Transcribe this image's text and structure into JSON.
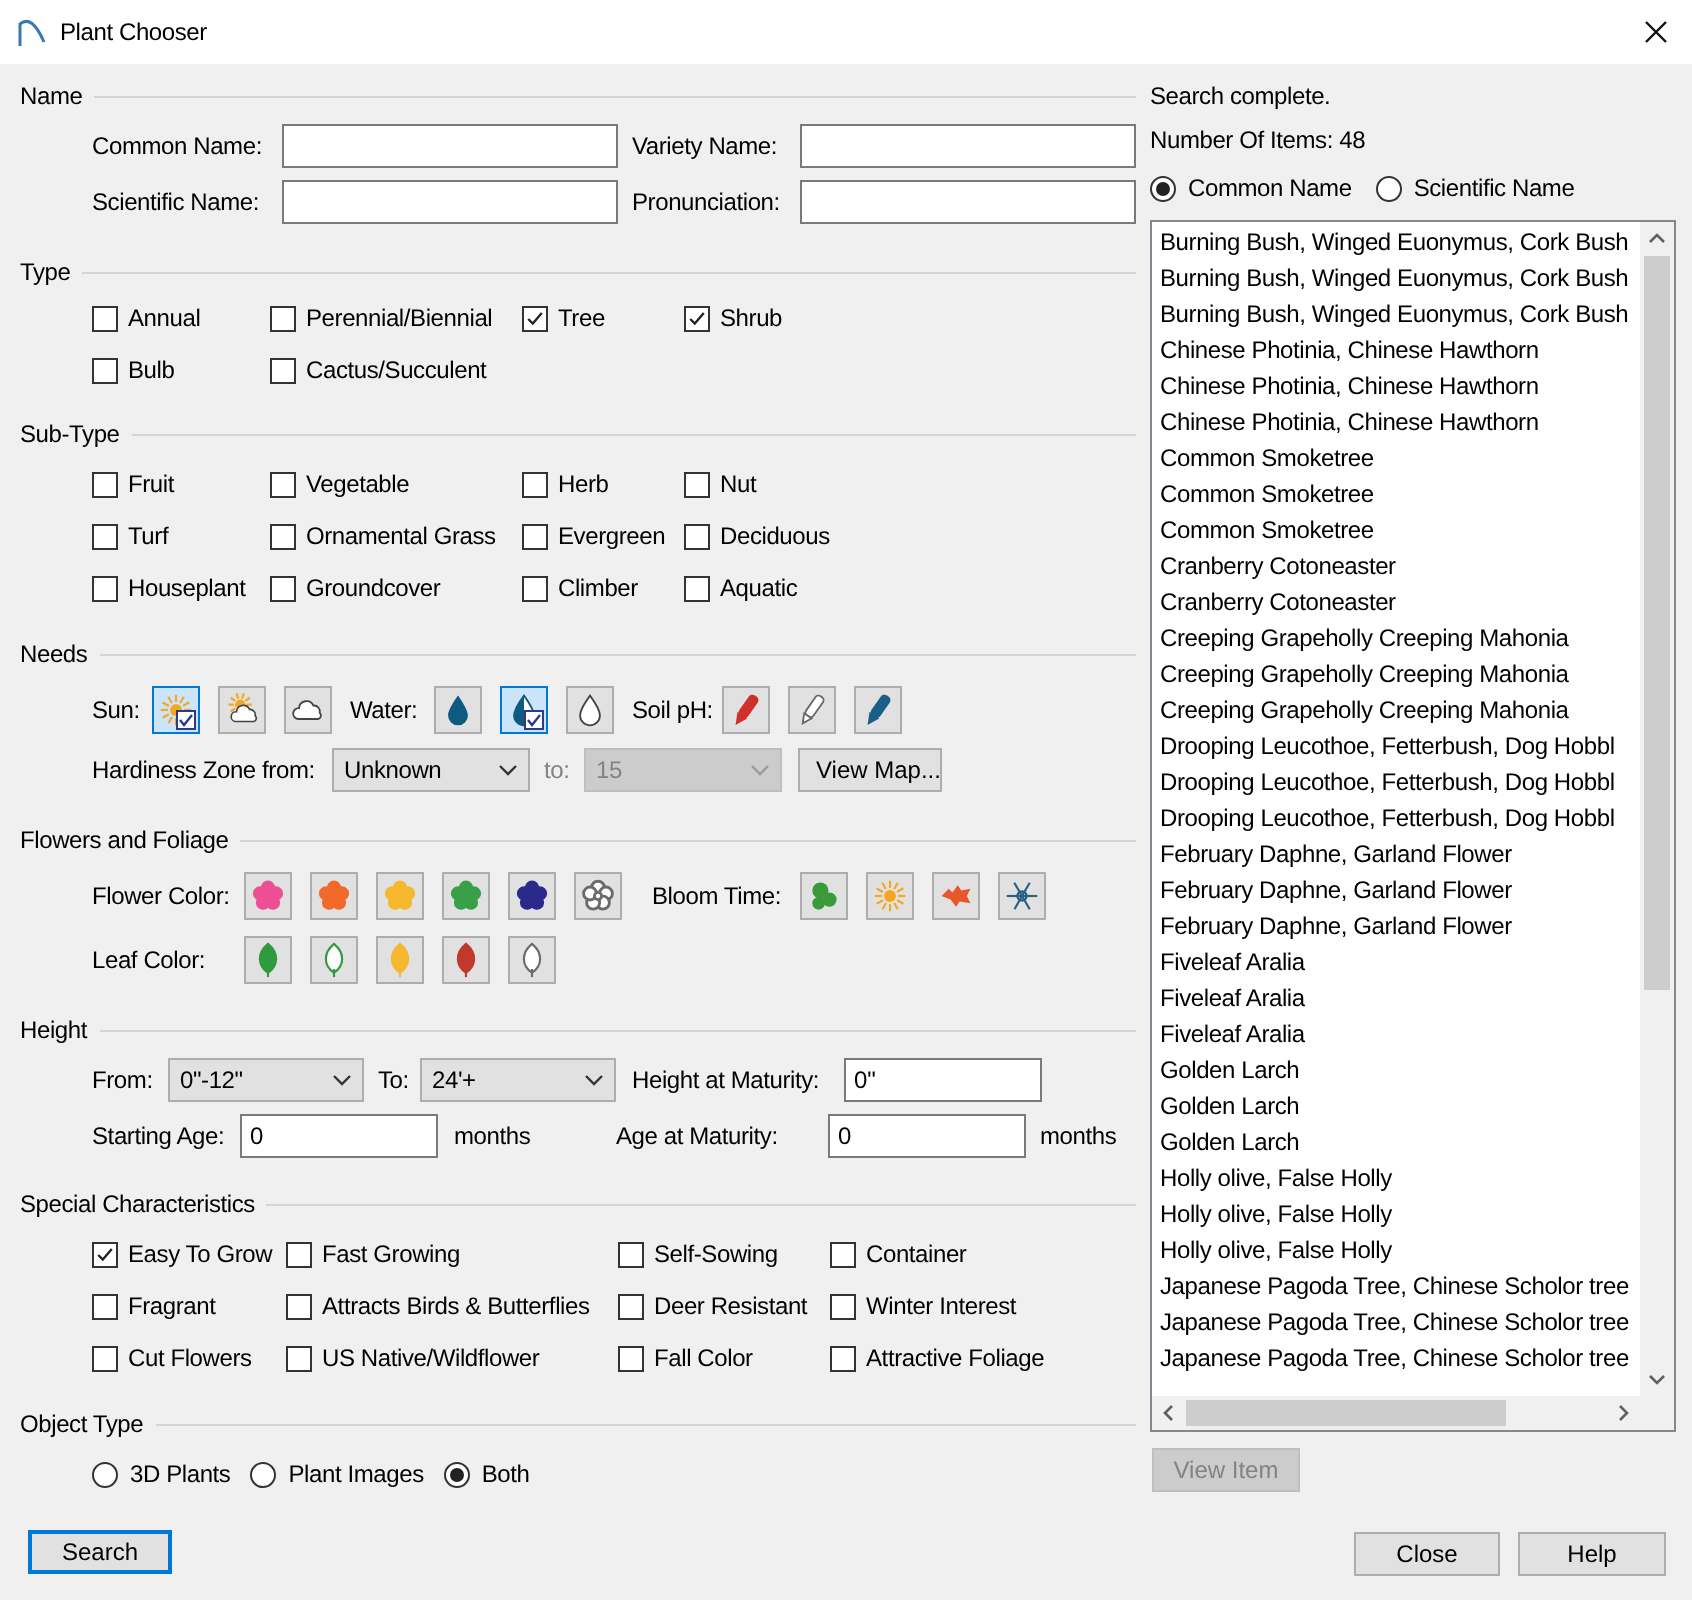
{
  "window": {
    "title": "Plant Chooser"
  },
  "name_section": {
    "title": "Name",
    "fields": [
      {
        "label": "Common Name:"
      },
      {
        "label": "Variety Name:"
      },
      {
        "label": "Scientific Name:"
      },
      {
        "label": "Pronunciation:"
      }
    ]
  },
  "type": {
    "title": "Type",
    "options": [
      {
        "label": "Annual",
        "checked": false
      },
      {
        "label": "Perennial/Biennial",
        "checked": false
      },
      {
        "label": "Tree",
        "checked": true
      },
      {
        "label": "Shrub",
        "checked": true
      },
      {
        "label": "Bulb",
        "checked": false
      },
      {
        "label": "Cactus/Succulent",
        "checked": false
      }
    ]
  },
  "sub_type": {
    "title": "Sub-Type",
    "options": [
      {
        "label": "Fruit",
        "checked": false
      },
      {
        "label": "Vegetable",
        "checked": false
      },
      {
        "label": "Herb",
        "checked": false
      },
      {
        "label": "Nut",
        "checked": false
      },
      {
        "label": "Turf",
        "checked": false
      },
      {
        "label": "Ornamental Grass",
        "checked": false
      },
      {
        "label": "Evergreen",
        "checked": false
      },
      {
        "label": "Deciduous",
        "checked": false
      },
      {
        "label": "Houseplant",
        "checked": false
      },
      {
        "label": "Groundcover",
        "checked": false
      },
      {
        "label": "Climber",
        "checked": false
      },
      {
        "label": "Aquatic",
        "checked": false
      }
    ]
  },
  "needs": {
    "title": "Needs",
    "sun": {
      "label": "Sun:",
      "options": [
        {
          "kind": "full",
          "selected": true
        },
        {
          "kind": "partial",
          "selected": false
        },
        {
          "kind": "shade",
          "selected": false
        }
      ]
    },
    "water": {
      "label": "Water:",
      "options": [
        {
          "kind": "high",
          "selected": false
        },
        {
          "kind": "medium",
          "selected": true
        },
        {
          "kind": "low",
          "selected": false
        }
      ]
    },
    "soil_ph": {
      "label": "Soil pH:",
      "options": [
        {
          "kind": "acidic",
          "selected": false
        },
        {
          "kind": "neutral",
          "selected": false
        },
        {
          "kind": "alkaline",
          "selected": false
        }
      ]
    },
    "hardiness": {
      "label": "Hardiness Zone from:",
      "from": {
        "value": "Unknown",
        "disabled": false
      },
      "to_label": "to:",
      "to": {
        "value": "15",
        "disabled": true
      },
      "map_button": "View Map..."
    }
  },
  "flowers_foliage": {
    "title": "Flowers and Foliage",
    "flower_color": {
      "label": "Flower Color:",
      "options": [
        {
          "kind": "filled",
          "color": "#ec4f93",
          "selected": false
        },
        {
          "kind": "filled",
          "color": "#f26a2b",
          "selected": false
        },
        {
          "kind": "filled",
          "color": "#f5b82e",
          "selected": false
        },
        {
          "kind": "filled",
          "color": "#3aa047",
          "selected": false
        },
        {
          "kind": "filled",
          "color": "#2b2a8c",
          "selected": false
        },
        {
          "kind": "outline",
          "color": "#6b6b6b",
          "selected": false
        }
      ]
    },
    "bloom_time": {
      "label": "Bloom Time:",
      "options": [
        {
          "kind": "spring",
          "selected": false
        },
        {
          "kind": "summer",
          "selected": false
        },
        {
          "kind": "fall",
          "selected": false
        },
        {
          "kind": "winter",
          "selected": false
        }
      ]
    },
    "leaf_color": {
      "label": "Leaf Color:",
      "options": [
        {
          "kind": "filled",
          "color": "#2f9a3e",
          "selected": false
        },
        {
          "kind": "outline",
          "color": "#2f9a3e",
          "selected": false
        },
        {
          "kind": "filled",
          "color": "#f5b82e",
          "selected": false
        },
        {
          "kind": "filled",
          "color": "#c0392b",
          "selected": false
        },
        {
          "kind": "outline",
          "color": "#6b6b6b",
          "selected": false
        }
      ]
    }
  },
  "height": {
    "title": "Height",
    "from": {
      "label": "From:",
      "value": "0\"-12\""
    },
    "to": {
      "label": "To:",
      "value": "24'+"
    },
    "height_at_maturity": {
      "label": "Height at Maturity:",
      "value": "0\""
    },
    "starting_age": {
      "label": "Starting Age:",
      "value": "0",
      "unit": "months"
    },
    "age_at_maturity": {
      "label": "Age at Maturity:",
      "value": "0",
      "unit": "months"
    }
  },
  "special": {
    "title": "Special Characteristics",
    "options": [
      {
        "label": "Easy To Grow",
        "checked": true
      },
      {
        "label": "Fast Growing",
        "checked": false
      },
      {
        "label": "Self-Sowing",
        "checked": false
      },
      {
        "label": "Container",
        "checked": false
      },
      {
        "label": "Fragrant",
        "checked": false
      },
      {
        "label": "Attracts Birds & Butterflies",
        "checked": false
      },
      {
        "label": "Deer Resistant",
        "checked": false
      },
      {
        "label": "Winter Interest",
        "checked": false
      },
      {
        "label": "Cut Flowers",
        "checked": false
      },
      {
        "label": "US Native/Wildflower",
        "checked": false
      },
      {
        "label": "Fall Color",
        "checked": false
      },
      {
        "label": "Attractive Foliage",
        "checked": false
      }
    ]
  },
  "object_type": {
    "title": "Object Type",
    "options": [
      {
        "label": "3D Plants",
        "selected": false
      },
      {
        "label": "Plant Images",
        "selected": false
      },
      {
        "label": "Both",
        "selected": true
      }
    ]
  },
  "search_button": "Search",
  "results": {
    "status": "Search complete.",
    "count": "Number Of Items: 48",
    "sort": [
      {
        "label": "Common Name",
        "selected": true
      },
      {
        "label": "Scientific Name",
        "selected": false
      }
    ],
    "items": [
      "Burning Bush, Winged Euonymus, Cork Bush",
      "Burning Bush, Winged Euonymus, Cork Bush",
      "Burning Bush, Winged Euonymus, Cork Bush",
      "Chinese Photinia, Chinese Hawthorn",
      "Chinese Photinia, Chinese Hawthorn",
      "Chinese Photinia, Chinese Hawthorn",
      "Common Smoketree",
      "Common Smoketree",
      "Common Smoketree",
      "Cranberry Cotoneaster",
      "Cranberry Cotoneaster",
      "Creeping Grapeholly Creeping Mahonia",
      "Creeping Grapeholly Creeping Mahonia",
      "Creeping Grapeholly Creeping Mahonia",
      "Drooping Leucothoe, Fetterbush, Dog Hobbl",
      "Drooping Leucothoe, Fetterbush, Dog Hobbl",
      "Drooping Leucothoe, Fetterbush, Dog Hobbl",
      "February Daphne, Garland Flower",
      "February Daphne, Garland Flower",
      "February Daphne, Garland Flower",
      "Fiveleaf Aralia",
      "Fiveleaf Aralia",
      "Fiveleaf Aralia",
      "Golden Larch",
      "Golden Larch",
      "Golden Larch",
      "Holly olive, False Holly",
      "Holly olive, False Holly",
      "Holly olive, False Holly",
      "Japanese Pagoda Tree, Chinese Scholor tree",
      "Japanese Pagoda Tree, Chinese Scholor tree",
      "Japanese Pagoda Tree, Chinese Scholor tree"
    ],
    "view_button": {
      "label": "View Item",
      "disabled": true
    }
  },
  "buttons": [
    "Close",
    "Help"
  ]
}
